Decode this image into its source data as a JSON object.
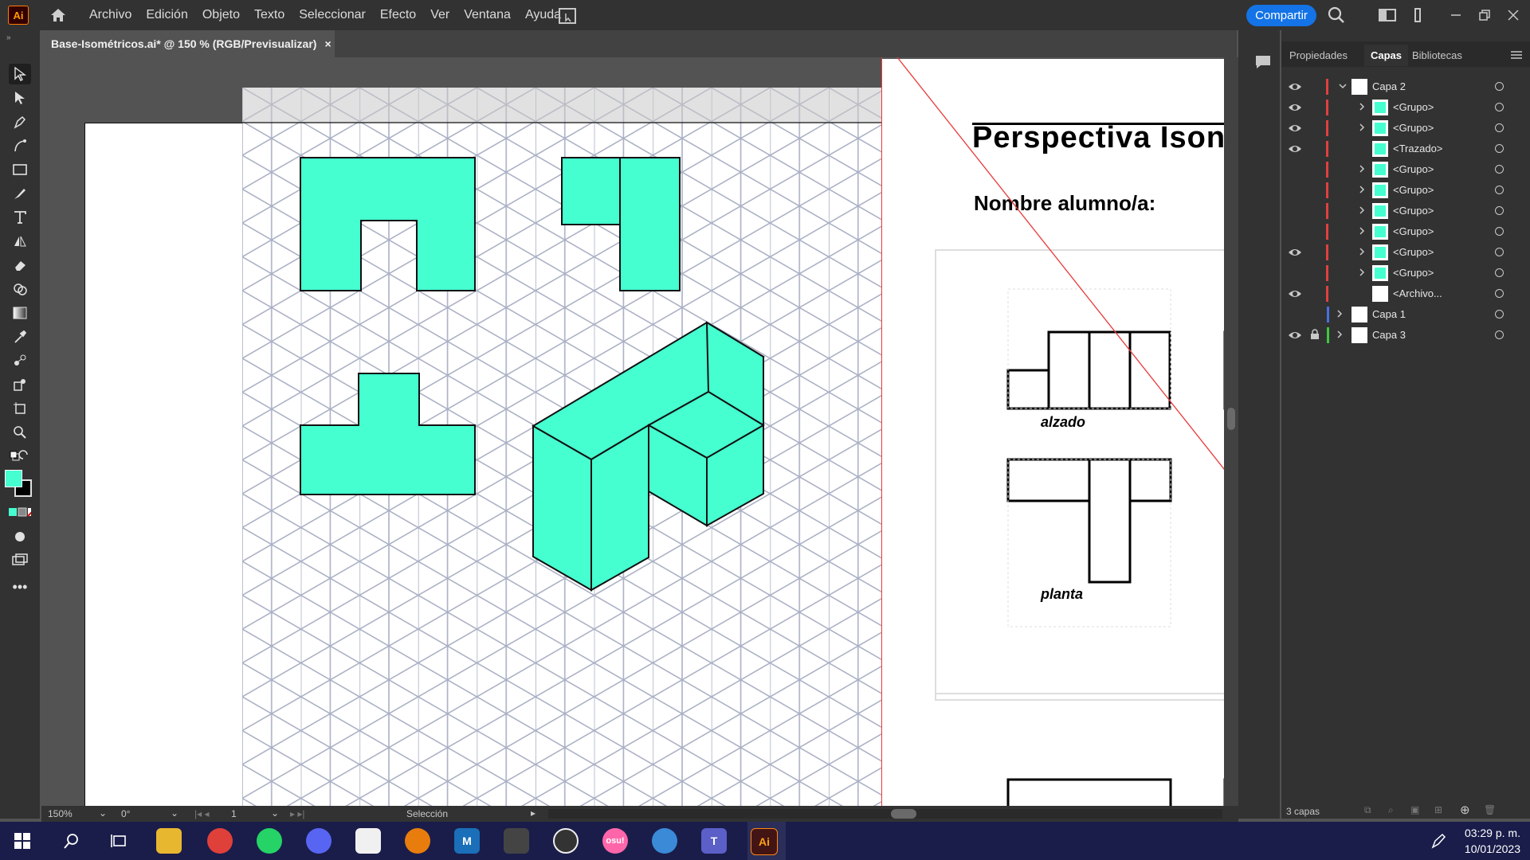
{
  "app": {
    "logo": "Ai",
    "menu": [
      "Archivo",
      "Edición",
      "Objeto",
      "Texto",
      "Seleccionar",
      "Efecto",
      "Ver",
      "Ventana",
      "Ayuda"
    ],
    "share_label": "Compartir"
  },
  "document": {
    "tab_title": "Base-Isométricos.ai* @ 150 % (RGB/Previsualizar)",
    "close_glyph": "×"
  },
  "artboard": {
    "heading": "Perspectiva Ison",
    "student_label": "Nombre alumno/a:",
    "label_alzado": "alzado",
    "label_planta": "planta"
  },
  "colors": {
    "shape_fill": "#45ffd0",
    "accent_blue": "#1473e6",
    "layer2_color": "#e04040",
    "layer1_color": "#4a6fe0",
    "layer3_color": "#3ec93e"
  },
  "panel": {
    "tabs": [
      "Propiedades",
      "Capas",
      "Bibliotecas"
    ],
    "active_tab": "Capas",
    "layers": [
      {
        "name": "Capa 2",
        "level": 0,
        "eye": true,
        "expanded": true
      },
      {
        "name": "<Grupo>",
        "level": 1,
        "eye": true
      },
      {
        "name": "<Grupo>",
        "level": 1,
        "eye": true
      },
      {
        "name": "<Trazado>",
        "level": 1,
        "eye": true
      },
      {
        "name": "<Grupo>",
        "level": 1,
        "eye": false
      },
      {
        "name": "<Grupo>",
        "level": 1,
        "eye": false
      },
      {
        "name": "<Grupo>",
        "level": 1,
        "eye": false
      },
      {
        "name": "<Grupo>",
        "level": 1,
        "eye": false
      },
      {
        "name": "<Grupo>",
        "level": 1,
        "eye": true
      },
      {
        "name": "<Grupo>",
        "level": 1,
        "eye": false
      },
      {
        "name": "<Archivo...",
        "level": 1,
        "eye": true
      },
      {
        "name": "Capa 1",
        "level": 0,
        "eye": false
      },
      {
        "name": "Capa 3",
        "level": 0,
        "eye": true,
        "locked": true
      }
    ],
    "footer_count": "3 capas"
  },
  "status": {
    "zoom": "150%",
    "rotation": "0°",
    "artboard_num": "1",
    "tool": "Selección"
  },
  "taskbar": {
    "time": "03:29 p. m.",
    "date": "10/01/2023"
  }
}
